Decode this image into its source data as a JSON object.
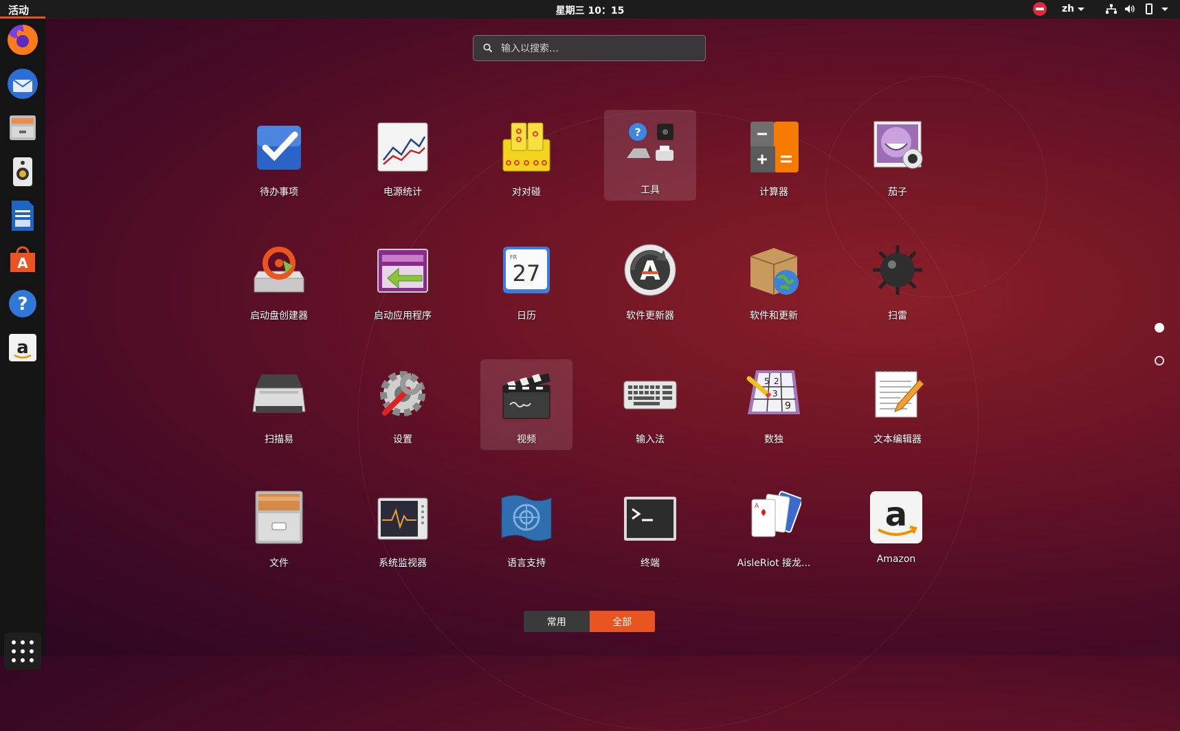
{
  "topbar": {
    "activities": "活动",
    "clock": "星期三 10：15",
    "lang": "zh"
  },
  "search": {
    "placeholder": "输入以搜索…"
  },
  "dock": {
    "items": [
      "firefox-icon",
      "thunderbird-icon",
      "file-cabinet-icon",
      "rhythmbox-icon",
      "writer-icon",
      "software-store-icon",
      "help-icon",
      "amazon-icon"
    ]
  },
  "apps": [
    {
      "label": "待办事项"
    },
    {
      "label": "电源统计"
    },
    {
      "label": "对对碰"
    },
    {
      "label": "工具"
    },
    {
      "label": "计算器"
    },
    {
      "label": "茄子"
    },
    {
      "label": "启动盘创建器"
    },
    {
      "label": "启动应用程序"
    },
    {
      "label": "日历"
    },
    {
      "label": "软件更新器"
    },
    {
      "label": "软件和更新"
    },
    {
      "label": "扫雷"
    },
    {
      "label": "扫描易"
    },
    {
      "label": "设置"
    },
    {
      "label": "视频"
    },
    {
      "label": "输入法"
    },
    {
      "label": "数独"
    },
    {
      "label": "文本编辑器"
    },
    {
      "label": "文件"
    },
    {
      "label": "系统监视器"
    },
    {
      "label": "语言支持"
    },
    {
      "label": "终端"
    },
    {
      "label": "AisleRiot 接龙..."
    },
    {
      "label": "Amazon"
    }
  ],
  "calendar": {
    "day": "27",
    "weekday": "FR"
  },
  "sudoku": {
    "digits": [
      "5",
      "2",
      "3",
      "9"
    ]
  },
  "switch": {
    "frequent": "常用",
    "all": "全部"
  },
  "colors": {
    "accent": "#e95420",
    "topbar": "#1c1c1c",
    "dock": "#141414"
  }
}
